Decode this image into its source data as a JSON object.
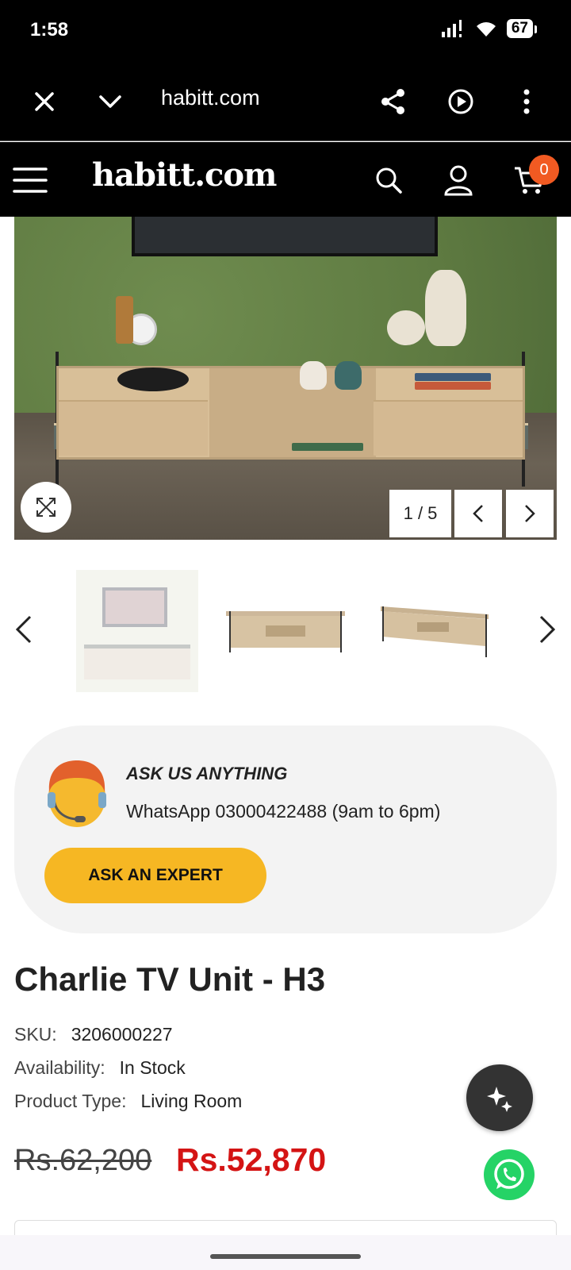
{
  "status": {
    "time": "1:58",
    "battery": "67"
  },
  "browser": {
    "url": "habitt.com"
  },
  "site": {
    "logo": "habitt.com",
    "cart_count": "0"
  },
  "gallery": {
    "counter": "1 / 5"
  },
  "expert": {
    "title": "ASK US ANYTHING",
    "line": "WhatsApp 03000422488 (9am to 6pm)",
    "button": "ASK AN EXPERT"
  },
  "product": {
    "title": "Charlie TV Unit - H3",
    "sku_label": "SKU:",
    "sku": "3206000227",
    "availability_label": "Availability:",
    "availability": "In Stock",
    "type_label": "Product Type:",
    "type": "Living Room",
    "price_old": "Rs.62,200",
    "price_new": "Rs.52,870"
  },
  "colors": {
    "sale": "#d41414",
    "accent": "#f6b723",
    "badge": "#f15a22",
    "whatsapp": "#25d366"
  },
  "icons": [
    "close-icon",
    "chevron-down-icon",
    "share-icon",
    "play-icon",
    "more-vert-icon",
    "menu-icon",
    "search-icon",
    "user-icon",
    "cart-icon",
    "expand-icon",
    "chevron-left-icon",
    "chevron-right-icon",
    "sparkle-icon",
    "whatsapp-icon"
  ]
}
